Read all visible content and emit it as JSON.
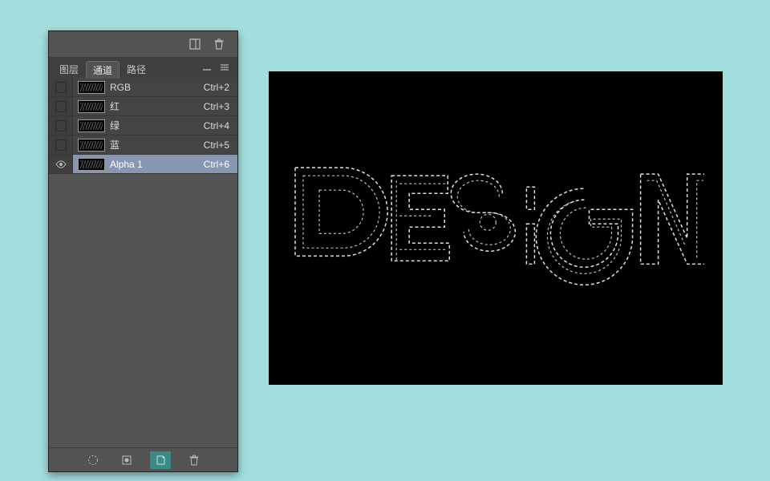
{
  "tabs": {
    "layers": "图层",
    "channels": "通道",
    "paths": "路径"
  },
  "channels": [
    {
      "name": "RGB",
      "shortcut": "Ctrl+2",
      "visible": false,
      "selected": false
    },
    {
      "name": "红",
      "shortcut": "Ctrl+3",
      "visible": false,
      "selected": false
    },
    {
      "name": "绿",
      "shortcut": "Ctrl+4",
      "visible": false,
      "selected": false
    },
    {
      "name": "蓝",
      "shortcut": "Ctrl+5",
      "visible": false,
      "selected": false
    },
    {
      "name": "Alpha 1",
      "shortcut": "Ctrl+6",
      "visible": true,
      "selected": true
    }
  ],
  "canvas": {
    "artwork_label": "DESIGN"
  }
}
